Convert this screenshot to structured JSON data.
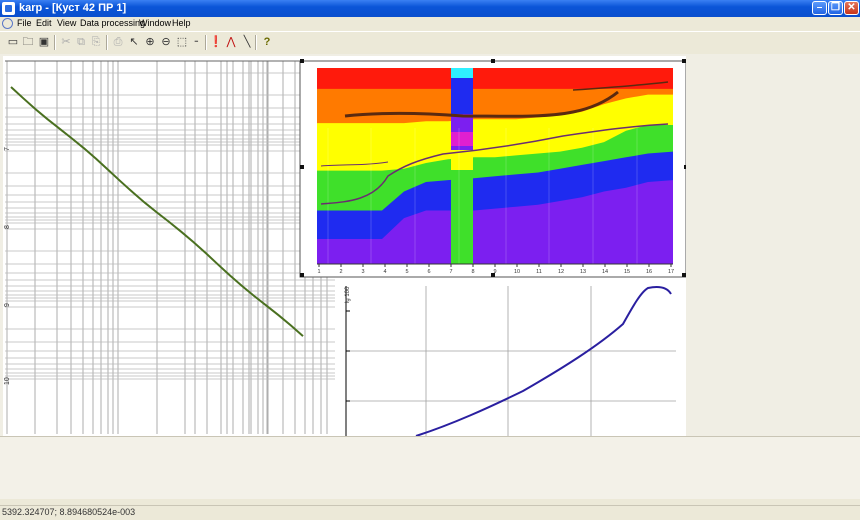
{
  "window": {
    "title": "karp - [Куст 42 ПР 1]",
    "minimize_glyph": "–",
    "maximize_glyph": "❐",
    "close_glyph": "✕"
  },
  "menu": {
    "items": [
      "File",
      "Edit",
      "View",
      "Data processing",
      "Window",
      "Help"
    ]
  },
  "toolbar": {
    "buttons": [
      {
        "icon": "open-folder-icon",
        "glyph": "🗀"
      },
      {
        "icon": "save-icon",
        "glyph": "▣"
      },
      {
        "icon": "cut-icon",
        "glyph": "✂"
      },
      {
        "icon": "copy-icon",
        "glyph": "⧉"
      },
      {
        "icon": "paste-icon",
        "glyph": "⎘"
      },
      {
        "icon": "print-icon",
        "glyph": "⎙"
      },
      {
        "icon": "pointer-icon",
        "glyph": "↖"
      },
      {
        "icon": "zoom-in-icon",
        "glyph": "⊕"
      },
      {
        "icon": "zoom-out-icon",
        "glyph": "⊖"
      },
      {
        "icon": "zoom-window-icon",
        "glyph": "⬚"
      },
      {
        "icon": "line-tool-icon",
        "glyph": "╴"
      },
      {
        "icon": "marker-icon",
        "glyph": "❗"
      },
      {
        "icon": "peak-icon",
        "glyph": "⋀"
      },
      {
        "icon": "slope-icon",
        "glyph": "╲"
      },
      {
        "icon": "help-icon",
        "glyph": "?"
      }
    ]
  },
  "section_plot": {
    "x_ticks": [
      "1",
      "2",
      "3",
      "4",
      "5",
      "6",
      "7",
      "8",
      "9",
      "10",
      "11",
      "12",
      "13",
      "14",
      "15",
      "16",
      "17"
    ],
    "colors": {
      "red": "#ff1a0c",
      "orange": "#ff7a00",
      "yellow": "#ffff00",
      "green": "#3fe02a",
      "blue": "#1f2bf0",
      "violet": "#7c1ff0",
      "cyan": "#2ff0ff",
      "magenta": "#e01fd0"
    }
  },
  "left_plot": {
    "y_ticks": [
      "7",
      "8",
      "9",
      "10"
    ],
    "line_color": "#4a7020"
  },
  "bottom_right_plot": {
    "y_label": "lg 100",
    "line_color": "#2a1fa0"
  },
  "status": {
    "coords": "5392.324707; 8.894680524e-003"
  }
}
